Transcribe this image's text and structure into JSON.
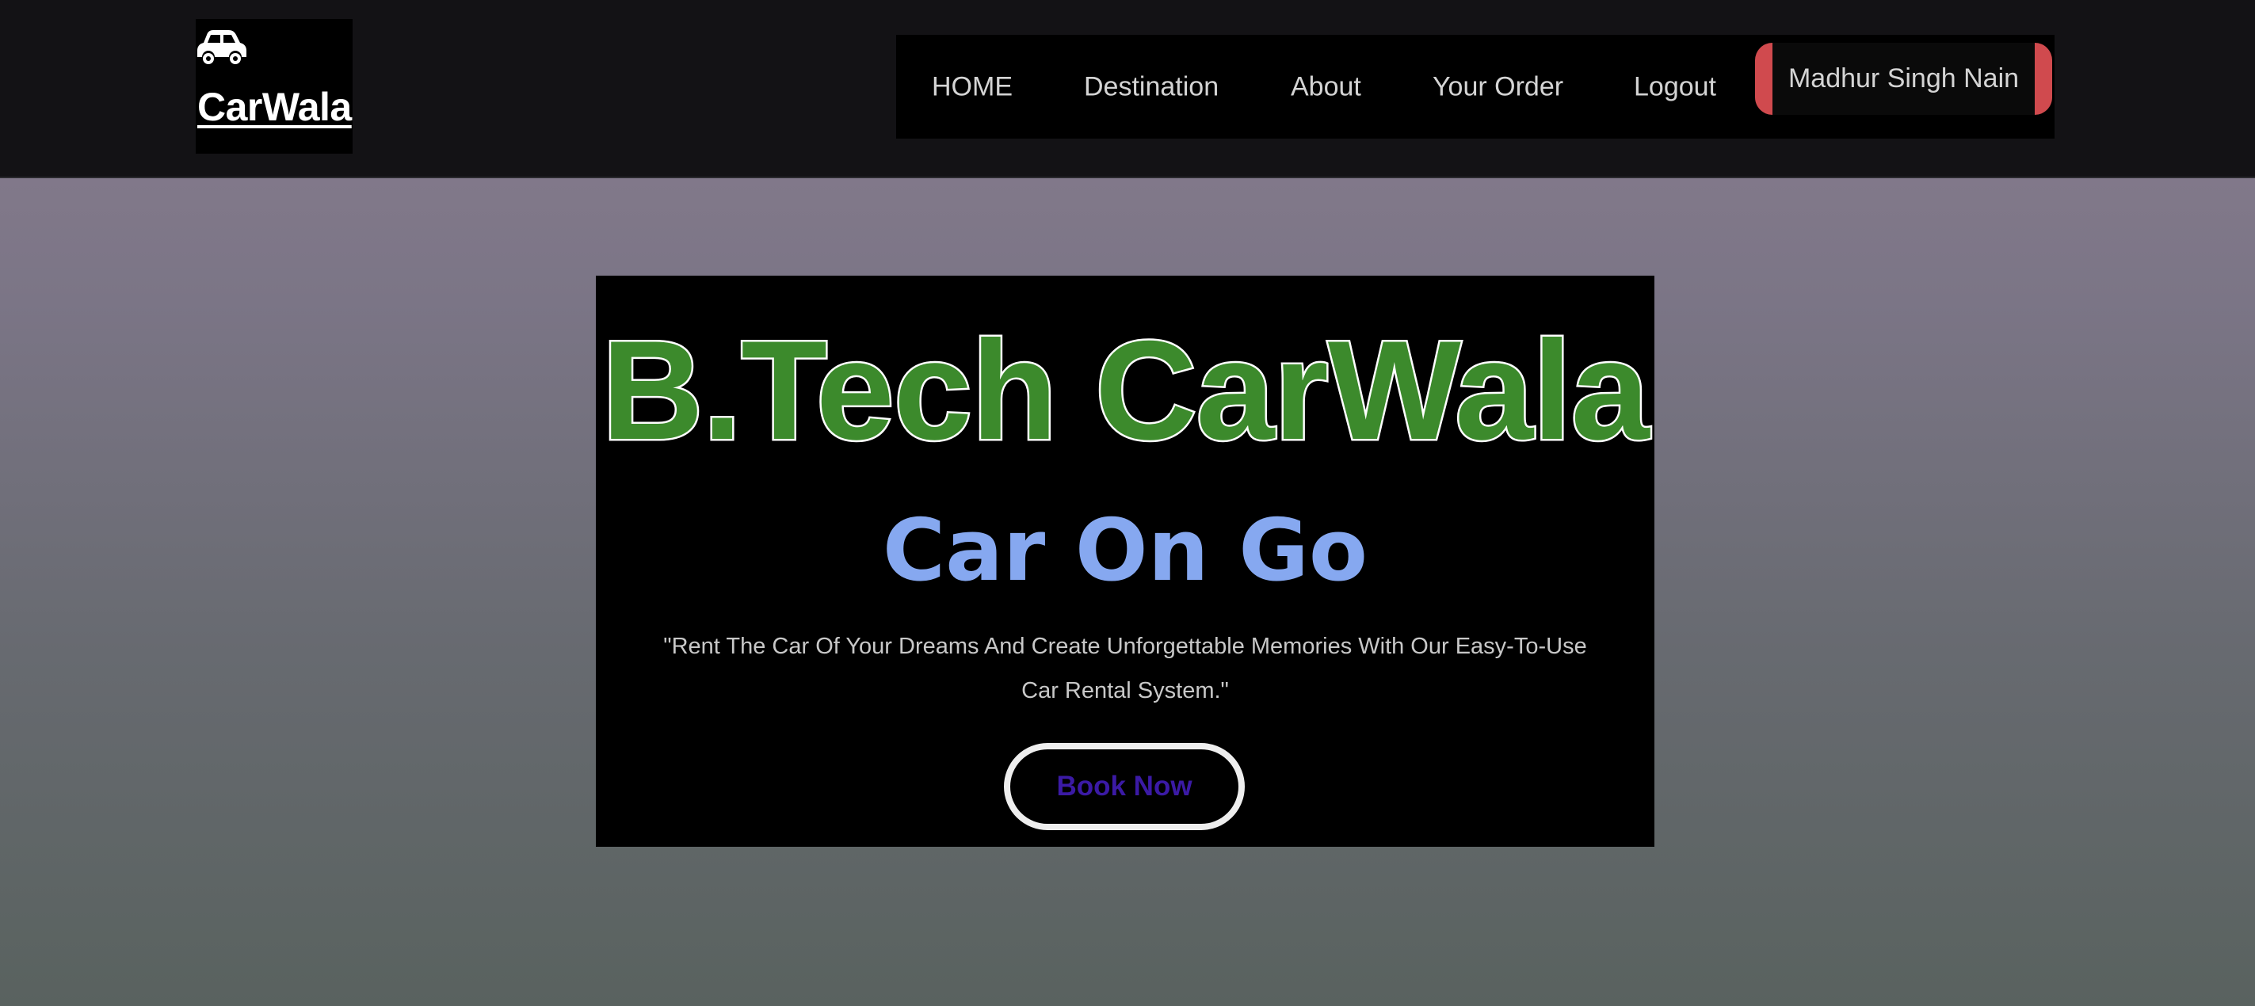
{
  "brand": {
    "icon": "car-icon",
    "name": "CarWala"
  },
  "nav": {
    "items": [
      {
        "label": "HOME"
      },
      {
        "label": "Destination"
      },
      {
        "label": "About"
      },
      {
        "label": "Your Order"
      },
      {
        "label": "Logout"
      }
    ],
    "user": "Madhur Singh Nain"
  },
  "hero": {
    "headline": "B.Tech CarWala",
    "subhead": "Car On Go",
    "tagline": "\"Rent The Car Of Your Dreams And Create Unforgettable Memories With Our Easy-To-Use Car Rental System.\"",
    "cta": "Book Now"
  },
  "colors": {
    "navbar_bg": "#131215",
    "headline_fill": "#3c8a2c",
    "subhead": "#86a8f0",
    "cta_text": "#3b1aa5",
    "user_accent": "#d04a4e"
  }
}
